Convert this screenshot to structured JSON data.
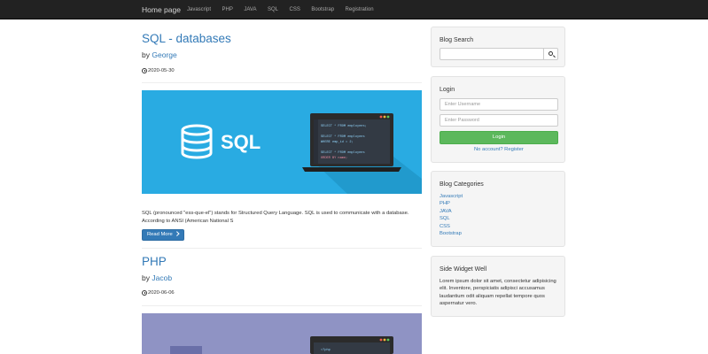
{
  "navbar": {
    "brand": "Home page",
    "links": [
      "Javascript",
      "PHP",
      "JAVA",
      "SQL",
      "CSS",
      "Bootstrap",
      "Registration"
    ]
  },
  "posts": [
    {
      "title": "SQL - databases",
      "author_prefix": "by",
      "author": "George",
      "date": "2020-05-30",
      "image_label": "SQL",
      "code_lines": [
        "SELECT * FROM employees;",
        "",
        "SELECT * FROM employees",
        "WHERE emp_id = 2;",
        "",
        "SELECT * FROM employees",
        "ORDER BY name;"
      ],
      "excerpt": "SQL (pronounced \"ess-que-el\") stands for Structured Query Language. SQL is used to communicate with a database. According to ANSI (American National S",
      "read_more": "Read More"
    },
    {
      "title": "PHP",
      "author_prefix": "by",
      "author": "Jacob",
      "date": "2020-06-06",
      "code_lines": [
        "<?php"
      ]
    }
  ],
  "sidebar": {
    "search": {
      "title": "Blog Search",
      "placeholder": ""
    },
    "login": {
      "title": "Login",
      "username_placeholder": "Enter Username",
      "password_placeholder": "Enter Password",
      "button": "Login",
      "register_link": "No account? Register"
    },
    "categories": {
      "title": "Blog Categories",
      "items": [
        "Javascript",
        "PHP",
        "JAVA",
        "SQL",
        "CSS",
        "Bootstrap"
      ]
    },
    "widget": {
      "title": "Side Widget Well",
      "text": "Lorem ipsum dolor sit amet, consectetur adipisicing elit. Inventore, perspiciatis adipisci accusamus laudantium odit aliquam repellat tempore quos aspernatur vero."
    }
  },
  "colors": {
    "navbar": "#222222",
    "link": "#337ab7",
    "login_button": "#5cb85c",
    "sql_banner": "#29abe2",
    "php_banner": "#8f93c4"
  }
}
